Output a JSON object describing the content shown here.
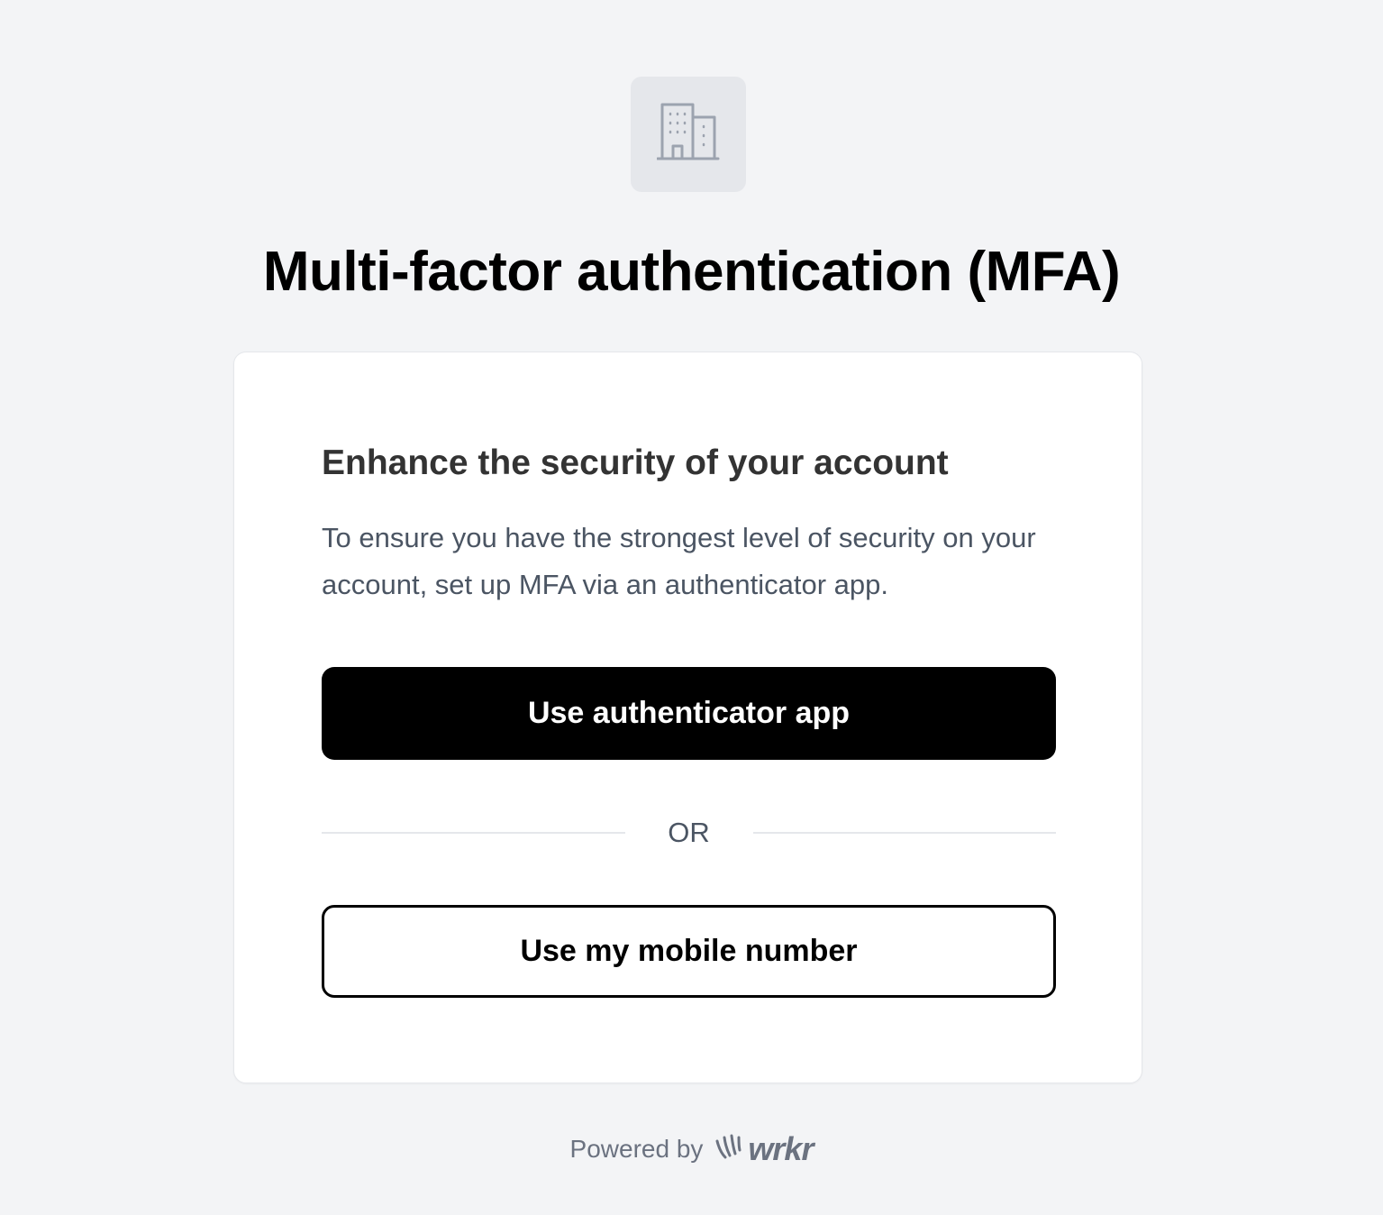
{
  "logo": {
    "icon": "building-icon"
  },
  "header": {
    "title": "Multi-factor authentication (MFA)"
  },
  "card": {
    "heading": "Enhance the security of your account",
    "description": "To ensure you have the strongest level of security on your account, set up MFA via an authenticator app.",
    "primary_button": "Use authenticator app",
    "divider_text": "OR",
    "secondary_button": "Use my mobile number"
  },
  "footer": {
    "powered_by": "Powered by",
    "brand_name": "wrkr",
    "brand_icon": "wrkr-logo-icon"
  },
  "colors": {
    "background": "#f3f4f6",
    "card": "#ffffff",
    "primary_button": "#000000",
    "muted_text": "#4b5563"
  }
}
